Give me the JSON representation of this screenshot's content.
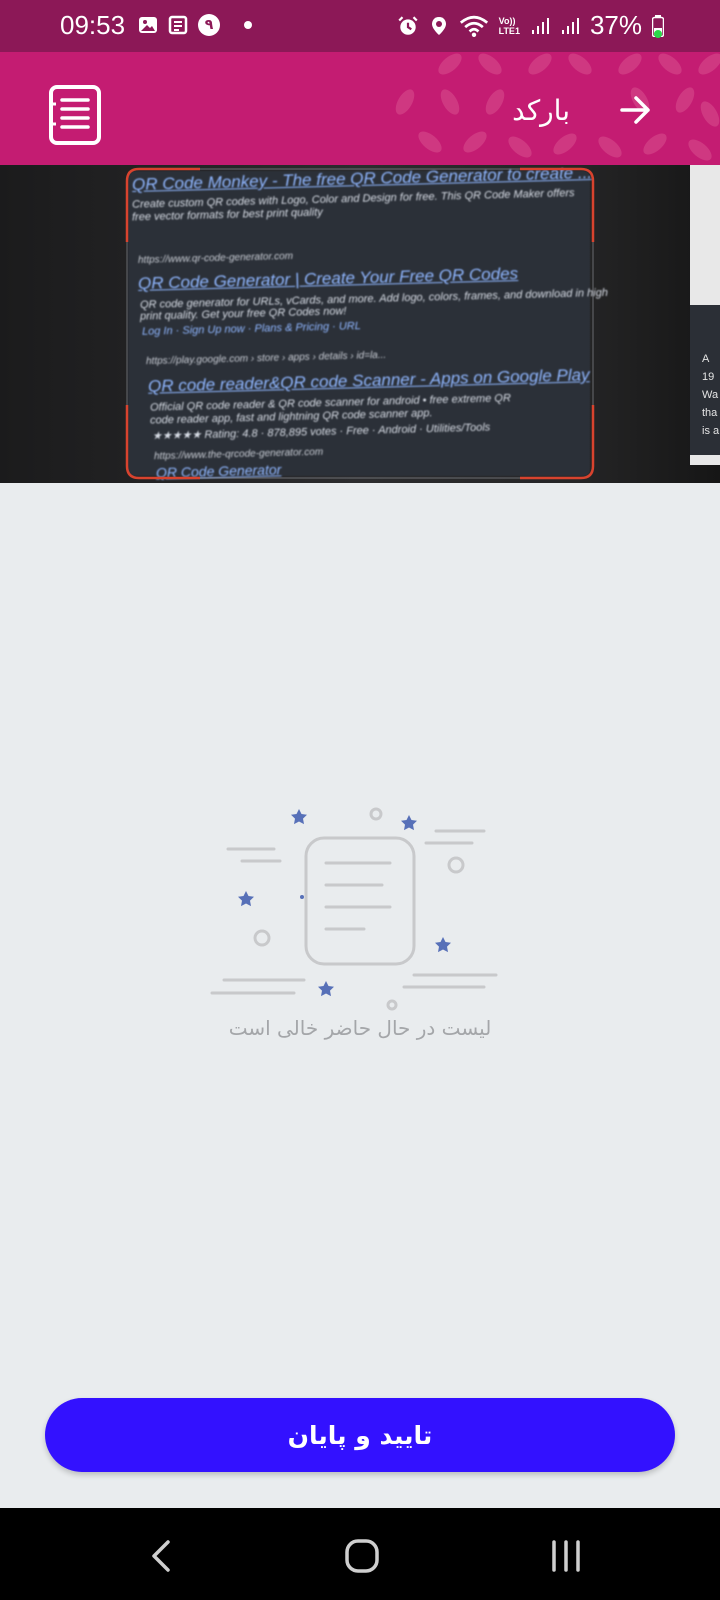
{
  "status_bar": {
    "time": "09:53",
    "notification_badge": "۹",
    "network_label_top": "Vo))",
    "network_label_bottom": "LTE1",
    "battery": "37%",
    "colors": {
      "bg": "#8c1857",
      "battery_dot": "#2bd84a"
    }
  },
  "header": {
    "title": "بارکد",
    "back_icon": "arrow-right-icon",
    "list_icon": "document-list-icon",
    "colors": {
      "bg": "#c41c72"
    }
  },
  "camera": {
    "lines": [
      {
        "kind": "link",
        "text": "QR Code Monkey - The free QR Code Generator to create ..."
      },
      {
        "kind": "text",
        "text": "Create custom QR codes with Logo, Color and Design for free. This QR Code Maker offers"
      },
      {
        "kind": "text",
        "text": "free vector formats for best print quality"
      },
      {
        "kind": "url",
        "text": "https://www.qr-code-generator.com"
      },
      {
        "kind": "link",
        "text": "QR Code Generator | Create Your Free QR Codes"
      },
      {
        "kind": "text",
        "text": "QR code generator for URLs, vCards, and more. Add logo, colors, frames, and download in high"
      },
      {
        "kind": "text",
        "text": "print quality. Get your free QR Codes now!"
      },
      {
        "kind": "text",
        "text": "Log In · Sign Up now · Plans & Pricing · URL"
      },
      {
        "kind": "url",
        "text": "https://play.google.com › store › apps › details › id=la..."
      },
      {
        "kind": "link",
        "text": "QR code reader&QR code Scanner - Apps on Google Play"
      },
      {
        "kind": "text",
        "text": "Official QR code reader & QR code scanner for android • free extreme QR"
      },
      {
        "kind": "text",
        "text": "code reader app, fast and lightning QR code scanner app."
      },
      {
        "kind": "text",
        "text": "★★★★★ Rating: 4.8 · 878,895 votes · Free · Android · Utilities/Tools"
      },
      {
        "kind": "url",
        "text": "https://www.the-qrcode-generator.com"
      },
      {
        "kind": "link",
        "text": "QR Code Generator"
      }
    ],
    "side_text": [
      "A",
      "19",
      "Wa",
      "tha",
      "is a"
    ]
  },
  "empty_state": {
    "illustration_icon": "empty-list-illustration-icon",
    "message": "لیست در حال حاضر خالی است"
  },
  "confirm_button": {
    "label": "تایید و پایان",
    "color": "#3311ff"
  },
  "nav_bar": {
    "back_icon": "nav-back-icon",
    "home_icon": "nav-home-icon",
    "recents_icon": "nav-recents-icon"
  }
}
